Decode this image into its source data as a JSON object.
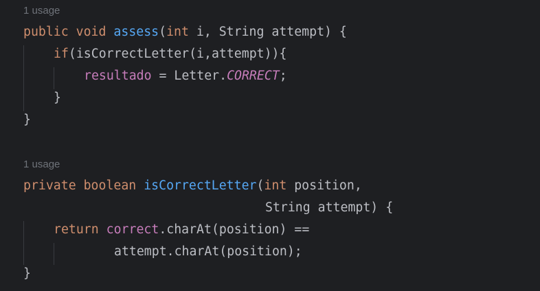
{
  "block1": {
    "usage_hint": "1 usage",
    "sig": {
      "kw1": "public",
      "kw2": "void",
      "name": "assess",
      "open_paren": "(",
      "kw_int": "int",
      "rest": " i, String attempt) {"
    },
    "if_line": {
      "kw": "if",
      "rest": "(isCorrectLetter(i,attempt)){"
    },
    "assign_line": {
      "field": "resultado",
      "mid": " = Letter.",
      "const": "CORRECT",
      "end": ";"
    },
    "inner_close": "}",
    "outer_close": "}"
  },
  "block2": {
    "usage_hint": "1 usage",
    "sig": {
      "kw1": "private",
      "kw2": "boolean",
      "name": "isCorrectLetter",
      "open_paren": "(",
      "kw_int": "int",
      "rest": " position,"
    },
    "sig_cont": "String attempt) {",
    "return_line": {
      "kw": "return",
      "field": "correct",
      "rest": ".charAt(position) =="
    },
    "cont_line": "attempt.charAt(position);",
    "close": "}"
  }
}
